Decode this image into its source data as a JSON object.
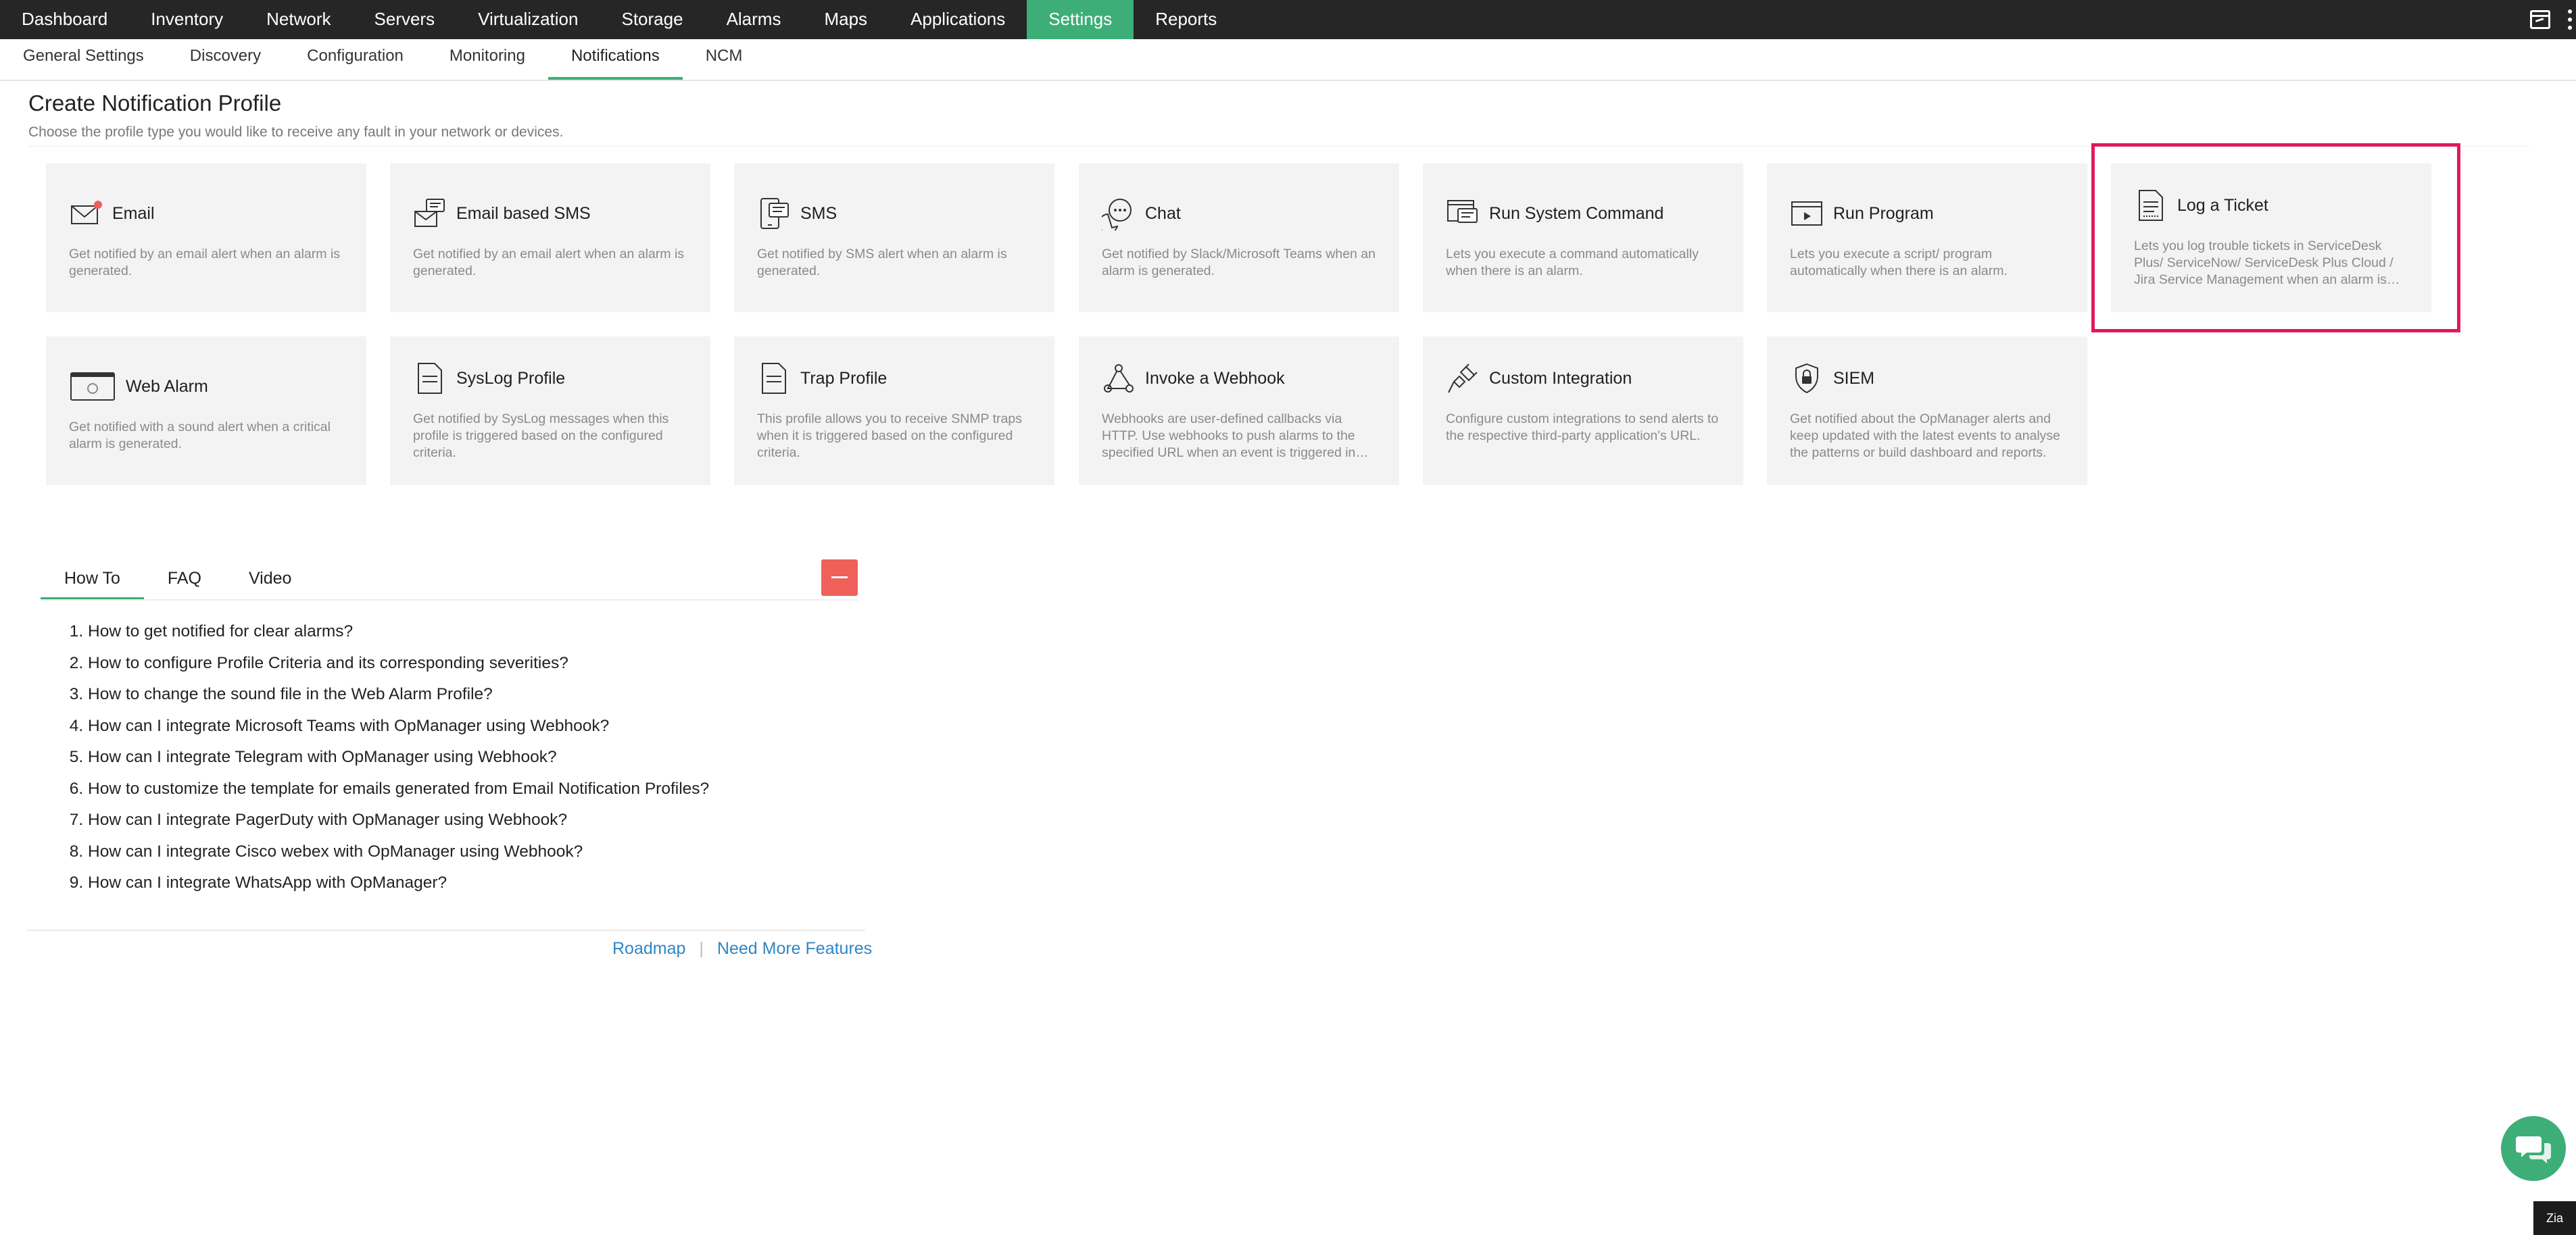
{
  "topnav": {
    "items": [
      {
        "label": "Dashboard"
      },
      {
        "label": "Inventory"
      },
      {
        "label": "Network"
      },
      {
        "label": "Servers"
      },
      {
        "label": "Virtualization"
      },
      {
        "label": "Storage"
      },
      {
        "label": "Alarms"
      },
      {
        "label": "Maps"
      },
      {
        "label": "Applications"
      },
      {
        "label": "Settings"
      },
      {
        "label": "Reports"
      }
    ],
    "active": "Settings",
    "accent_color": "#3dae77",
    "background_color": "#262626"
  },
  "subnav": {
    "items": [
      {
        "label": "General Settings"
      },
      {
        "label": "Discovery"
      },
      {
        "label": "Configuration"
      },
      {
        "label": "Monitoring"
      },
      {
        "label": "Notifications"
      },
      {
        "label": "NCM"
      }
    ],
    "active": "Notifications"
  },
  "page": {
    "title": "Create Notification Profile",
    "subtitle": "Choose the profile type you would like to receive any fault in your network or devices."
  },
  "profiles": [
    {
      "title": "Email",
      "icon": "email-icon",
      "desc": "Get notified by an email alert when an alarm is generated."
    },
    {
      "title": "Email based SMS",
      "icon": "email-sms-icon",
      "desc": "Get notified by an email alert when an alarm is generated."
    },
    {
      "title": "SMS",
      "icon": "sms-icon",
      "desc": "Get notified by SMS alert when an alarm is generated."
    },
    {
      "title": "Chat",
      "icon": "chat-icon",
      "desc": "Get notified by Slack/Microsoft Teams when an alarm is generated."
    },
    {
      "title": "Run System Command",
      "icon": "system-command-icon",
      "desc": "Lets you execute a command automatically when there is an alarm."
    },
    {
      "title": "Run Program",
      "icon": "run-program-icon",
      "desc": "Lets you execute a script/ program automatically when there is an alarm."
    },
    {
      "title": "Log a Ticket",
      "icon": "ticket-icon",
      "desc": "Lets you log trouble tickets in ServiceDesk Plus/ ServiceNow/ ServiceDesk Plus Cloud / Jira Service Management when an alarm is generated."
    },
    {
      "title": "Web Alarm",
      "icon": "web-alarm-icon",
      "desc": "Get notified with a sound alert when a critical alarm is generated."
    },
    {
      "title": "SysLog Profile",
      "icon": "syslog-icon",
      "desc": "Get notified by SysLog messages when this profile is triggered based on the configured criteria."
    },
    {
      "title": "Trap Profile",
      "icon": "trap-icon",
      "desc": "This profile allows you to receive SNMP traps when it is triggered based on the configured criteria."
    },
    {
      "title": "Invoke a Webhook",
      "icon": "webhook-icon",
      "desc": "Webhooks are user-defined callbacks via HTTP. Use webhooks to push alarms to the specified URL when an event is triggered in OpManager."
    },
    {
      "title": "Custom Integration",
      "icon": "plug-icon",
      "desc": "Configure custom integrations to send alerts to the respective third-party application's URL."
    },
    {
      "title": "SIEM",
      "icon": "shield-lock-icon",
      "desc": "Get notified about the OpManager alerts and keep updated with the latest events to analyse the patterns or build dashboard and reports."
    }
  ],
  "selected_profile": "Log a Ticket",
  "highlight_color": "#e0185f",
  "help": {
    "tabs": [
      {
        "label": "How To"
      },
      {
        "label": "FAQ"
      },
      {
        "label": "Video"
      }
    ],
    "active": "How To",
    "collapse_color": "#f0605a",
    "howto": [
      "How to get notified for clear alarms?",
      "How to configure Profile Criteria and its corresponding severities?",
      "How to change the sound file in the Web Alarm Profile?",
      "How can I integrate Microsoft Teams with OpManager using Webhook?",
      "How can I integrate Telegram with OpManager using Webhook?",
      "How to customize the template for emails generated from Email Notification Profiles?",
      "How can I integrate PagerDuty with OpManager using Webhook?",
      "How can I integrate Cisco webex with OpManager using Webhook?",
      "How can I integrate WhatsApp with OpManager?"
    ]
  },
  "footer": {
    "roadmap": "Roadmap",
    "separator": "|",
    "more_features": "Need More Features"
  },
  "corner_widget": {
    "label": "Zia"
  },
  "link_color": "#2f86c5"
}
